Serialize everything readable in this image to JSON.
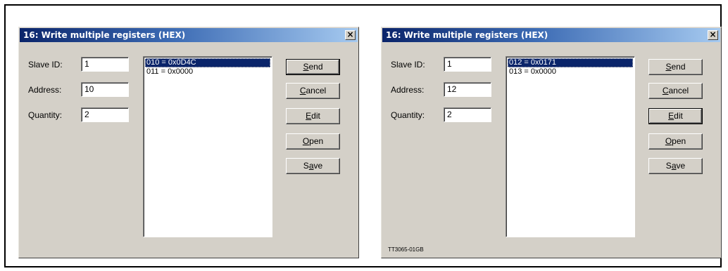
{
  "dialogs": [
    {
      "title": "16: Write multiple registers (HEX)",
      "close_glyph": "×",
      "fields": {
        "slave_id": {
          "label": "Slave ID:",
          "value": "1"
        },
        "address": {
          "label": "Address:",
          "value": "10"
        },
        "quantity": {
          "label": "Quantity:",
          "value": "2"
        }
      },
      "list_items": [
        "010 = 0x0D4C",
        "011 = 0x0000"
      ],
      "selected_index": 0,
      "buttons": {
        "send": {
          "accel": "S",
          "rest": "end"
        },
        "cancel": {
          "accel": "C",
          "rest": "ancel"
        },
        "edit": {
          "accel": "E",
          "rest": "dit"
        },
        "open": {
          "accel": "O",
          "rest": "pen"
        },
        "save": {
          "pre": "S",
          "accel": "a",
          "rest": "ve"
        }
      },
      "default_button": "send"
    },
    {
      "title": "16: Write multiple registers (HEX)",
      "close_glyph": "×",
      "fields": {
        "slave_id": {
          "label": "Slave ID:",
          "value": "1"
        },
        "address": {
          "label": "Address:",
          "value": "12"
        },
        "quantity": {
          "label": "Quantity:",
          "value": "2"
        }
      },
      "list_items": [
        "012 = 0x0171",
        "013 = 0x0000"
      ],
      "selected_index": 0,
      "buttons": {
        "send": {
          "accel": "S",
          "rest": "end"
        },
        "cancel": {
          "accel": "C",
          "rest": "ancel"
        },
        "edit": {
          "accel": "E",
          "rest": "dit"
        },
        "open": {
          "accel": "O",
          "rest": "pen"
        },
        "save": {
          "pre": "S",
          "accel": "a",
          "rest": "ve"
        }
      },
      "default_button": "edit"
    }
  ],
  "figure_tag": "TT3065-01GB"
}
